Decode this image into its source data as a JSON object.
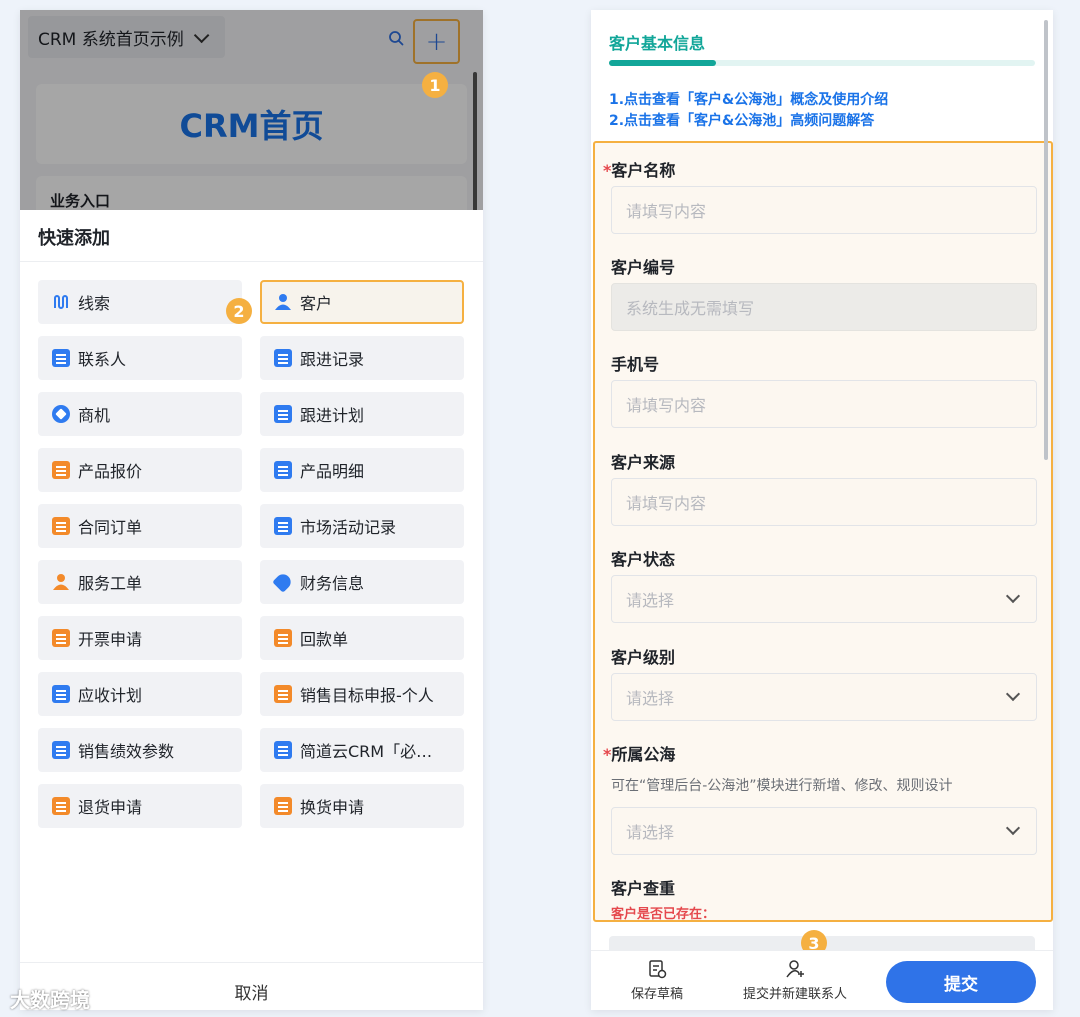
{
  "left": {
    "header": {
      "title_select": "CRM 系统首页示例",
      "plus_label": "+",
      "badge": "1"
    },
    "banner": "CRM首页",
    "business_entry": "业务入口",
    "sheet": {
      "title": "快速添加",
      "badge": "2",
      "cancel": "取消",
      "items": [
        {
          "label": "线索",
          "icon": "lead-icon"
        },
        {
          "label": "客户",
          "icon": "customer-icon"
        },
        {
          "label": "联系人",
          "icon": "contact-icon"
        },
        {
          "label": "跟进记录",
          "icon": "followup-record-icon"
        },
        {
          "label": "商机",
          "icon": "opportunity-icon"
        },
        {
          "label": "跟进计划",
          "icon": "followup-plan-icon"
        },
        {
          "label": "产品报价",
          "icon": "quote-icon"
        },
        {
          "label": "产品明细",
          "icon": "doc-icon"
        },
        {
          "label": "合同订单",
          "icon": "contract-icon"
        },
        {
          "label": "市场活动记录",
          "icon": "doc-icon"
        },
        {
          "label": "服务工单",
          "icon": "service-icon"
        },
        {
          "label": "财务信息",
          "icon": "tag-icon"
        },
        {
          "label": "开票申请",
          "icon": "invoice-icon"
        },
        {
          "label": "回款单",
          "icon": "doc-icon"
        },
        {
          "label": "应收计划",
          "icon": "receivable-icon"
        },
        {
          "label": "销售目标申报-个人",
          "icon": "target-icon"
        },
        {
          "label": "销售绩效参数",
          "icon": "doc-icon"
        },
        {
          "label": "简道云CRM「必…",
          "icon": "doc-icon"
        },
        {
          "label": "退货申请",
          "icon": "return-icon"
        },
        {
          "label": "换货申请",
          "icon": "exchange-icon"
        }
      ]
    },
    "watermark": "大数跨境"
  },
  "right": {
    "section_title": "客户基本信息",
    "progress": 0.25,
    "help": {
      "line1": "1.点击查看「客户&公海池」概念及使用介绍",
      "line2": "2.点击查看「客户&公海池」高频问题解答"
    },
    "fields": {
      "customer_name": {
        "label": "客户名称",
        "required": "*",
        "placeholder": "请填写内容"
      },
      "customer_no": {
        "label": "客户编号",
        "placeholder": "系统生成无需填写"
      },
      "phone": {
        "label": "手机号",
        "placeholder": "请填写内容"
      },
      "source": {
        "label": "客户来源",
        "placeholder": "请填写内容"
      },
      "status": {
        "label": "客户状态",
        "placeholder": "请选择"
      },
      "level": {
        "label": "客户级别",
        "placeholder": "请选择"
      },
      "pool": {
        "label": "所属公海",
        "required": "*",
        "hint": "可在“管理后台-公海池”模块进行新增、修改、规则设计",
        "placeholder": "请选择"
      },
      "dup_check": {
        "label": "客户查重",
        "warning": "客户是否已存在："
      }
    },
    "badge": "3",
    "bottom": {
      "save_draft": "保存草稿",
      "submit_new_contact": "提交并新建联系人",
      "submit": "提交"
    }
  },
  "colors": {
    "accent_blue": "#2f73e8",
    "teal": "#12a699",
    "highlight_orange": "#f5b041",
    "required_red": "#e5484d"
  }
}
